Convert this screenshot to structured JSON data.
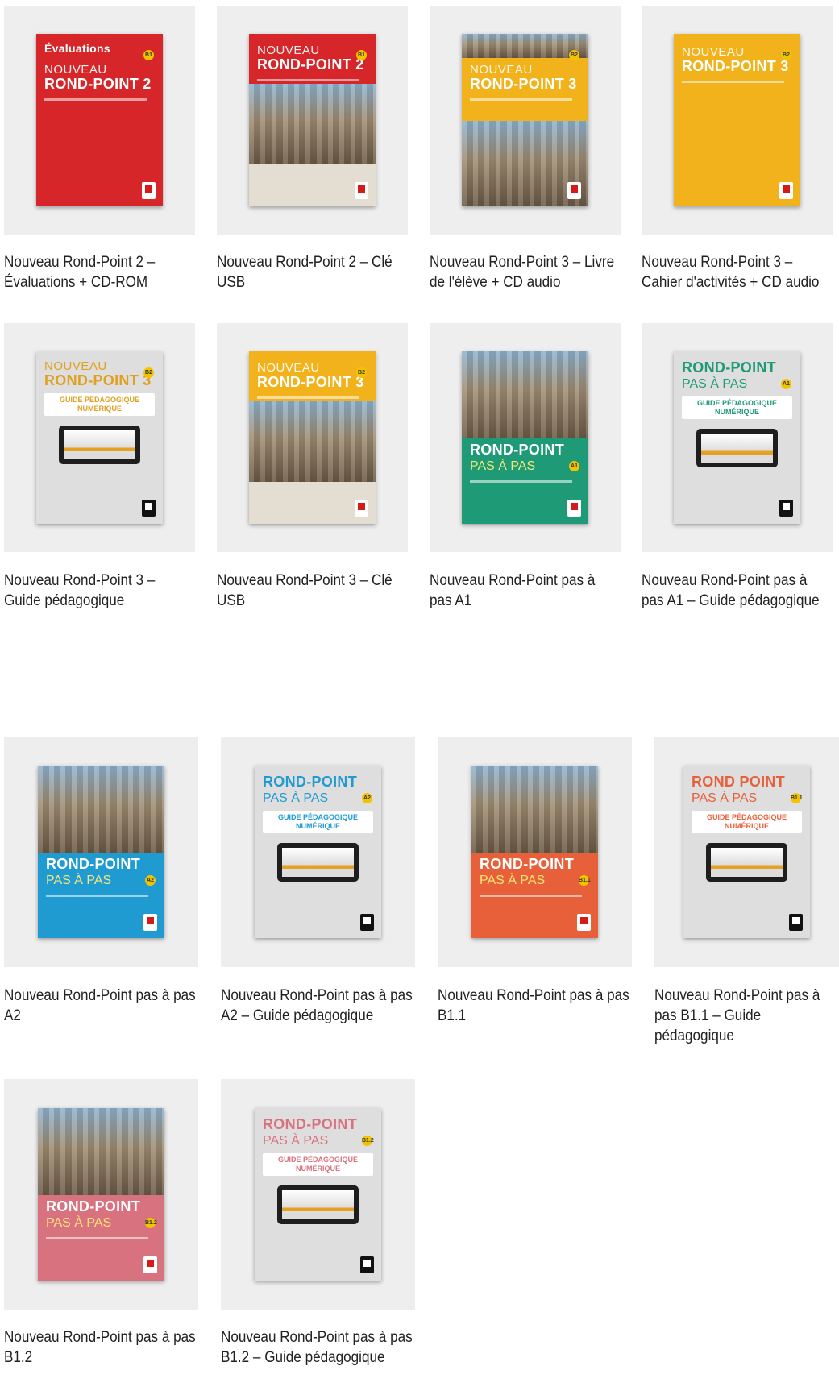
{
  "products": [
    {
      "title": "Nouveau Rond-Point 2 – Évaluations + CD-ROM",
      "cover": {
        "style": "eval",
        "bg": "#d6262a",
        "top_label": "Évaluations",
        "nouveau": "NOUVEAU",
        "brand": "ROND-POINT 2",
        "level": "B1"
      }
    },
    {
      "title": "Nouveau Rond-Point 2 – Clé USB",
      "cover": {
        "style": "usb",
        "bg": "#d6262a",
        "nouveau": "NOUVEAU",
        "brand": "ROND-POINT 2",
        "level": "B1"
      }
    },
    {
      "title": "Nouveau Rond-Point 3 – Livre de l'élève + CD audio",
      "cover": {
        "style": "photo-mid",
        "bg": "#f2b21b",
        "nouveau": "NOUVEAU",
        "brand": "ROND-POINT 3",
        "level": "B2"
      }
    },
    {
      "title": "Nouveau Rond-Point 3 – Cahier d'activités + CD audio",
      "cover": {
        "style": "solid",
        "bg": "#f2b21b",
        "nouveau": "NOUVEAU",
        "brand": "ROND-POINT 3",
        "level": "B2"
      }
    },
    {
      "title": "Nouveau Rond-Point 3 – Guide pédagogique",
      "cover": {
        "style": "guide",
        "bg": "#dedede",
        "accent": "#e0a020",
        "nouveau": "NOUVEAU",
        "brand": "ROND-POINT 3",
        "box": "GUIDE PÉDAGOGIQUE NUMÉRIQUE",
        "level": "B2"
      }
    },
    {
      "title": "Nouveau Rond-Point 3 – Clé USB",
      "cover": {
        "style": "usb",
        "bg": "#f2b21b",
        "nouveau": "NOUVEAU",
        "brand": "ROND-POINT 3",
        "level": "B2"
      }
    },
    {
      "title": "Nouveau Rond-Point pas à pas A1",
      "cover": {
        "style": "photo-top",
        "bg": "#1e9b76",
        "brand": "ROND-POINT",
        "sub": "PAS À PAS",
        "level": "A1"
      }
    },
    {
      "title": "Nouveau Rond-Point pas à pas A1 – Guide pédagogique",
      "cover": {
        "style": "guide",
        "bg": "#dedede",
        "accent": "#1e9b76",
        "brand": "ROND-POINT",
        "sub": "PAS À PAS",
        "box": "GUIDE PÉDAGOGIQUE NUMÉRIQUE",
        "level": "A1"
      }
    },
    {
      "title": "Nouveau Rond-Point pas à pas A2",
      "cover": {
        "style": "photo-top",
        "bg": "#1f9bd2",
        "brand": "ROND-POINT",
        "sub": "PAS À PAS",
        "level": "A2"
      }
    },
    {
      "title": "Nouveau Rond-Point pas à pas A2 – Guide pédagogique",
      "cover": {
        "style": "guide",
        "bg": "#dedede",
        "accent": "#1f9bd2",
        "brand": "ROND-POINT",
        "sub": "PAS À PAS",
        "box": "GUIDE PÉDAGOGIQUE NUMÉRIQUE",
        "level": "A2"
      }
    },
    {
      "title": "Nouveau Rond-Point pas à pas B1.1",
      "cover": {
        "style": "photo-top",
        "bg": "#e8603a",
        "brand": "ROND-POINT",
        "sub": "PAS À PAS",
        "level": "B1.1"
      }
    },
    {
      "title": "Nouveau Rond-Point pas à pas B1.1 – Guide pédagogique",
      "cover": {
        "style": "guide",
        "bg": "#dedede",
        "accent": "#e8603a",
        "brand": "ROND POINT",
        "sub": "PAS À PAS",
        "box": "GUIDE PÉDAGOGIQUE NUMÉRIQUE",
        "level": "B1.1"
      }
    },
    {
      "title": "Nouveau Rond-Point pas à pas B1.2",
      "cover": {
        "style": "photo-top",
        "bg": "#d9727f",
        "brand": "ROND-POINT",
        "sub": "PAS À PAS",
        "level": "B1.2"
      }
    },
    {
      "title": "Nouveau Rond-Point pas à pas B1.2 – Guide pédagogique",
      "cover": {
        "style": "guide",
        "bg": "#dedede",
        "accent": "#d9727f",
        "brand": "ROND-POINT",
        "sub": "PAS À PAS",
        "box": "GUIDE PÉDAGOGIQUE NUMÉRIQUE",
        "level": "B1.2"
      }
    }
  ]
}
